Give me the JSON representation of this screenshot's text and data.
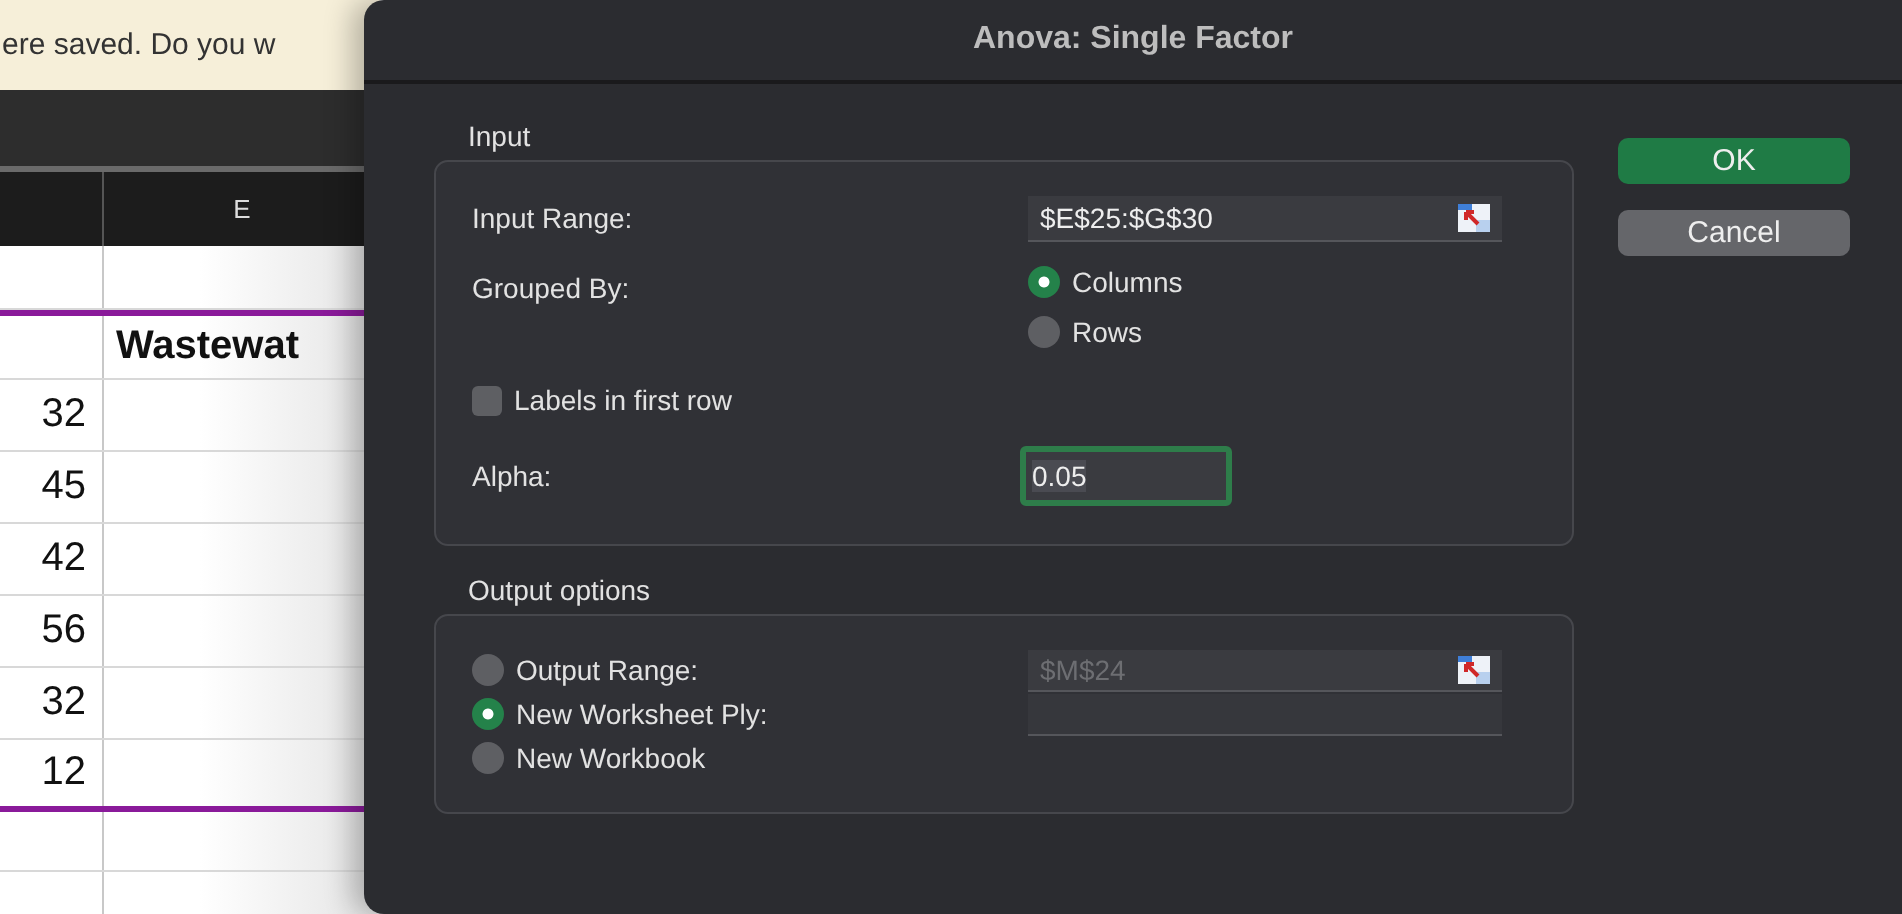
{
  "spreadsheet": {
    "notification": "ere saved. Do you w",
    "column_header": "E",
    "heading_cell": "Wastewat",
    "values": [
      "32",
      "45",
      "42",
      "56",
      "32",
      "12"
    ]
  },
  "dialog": {
    "title": "Anova: Single Factor",
    "input": {
      "label": "Input",
      "range_label": "Input Range:",
      "range_value": "$E$25:$G$30",
      "grouped_by_label": "Grouped By:",
      "grouped_options": [
        {
          "label": "Columns",
          "selected": true
        },
        {
          "label": "Rows",
          "selected": false
        }
      ],
      "labels_checkbox": {
        "label": "Labels in first row",
        "checked": false
      },
      "alpha_label": "Alpha:",
      "alpha_value": "0.05"
    },
    "output": {
      "label": "Output options",
      "options": [
        {
          "label": "Output Range:",
          "selected": false,
          "kind": "range",
          "value": "$M$24",
          "disabled": true
        },
        {
          "label": "New Worksheet Ply:",
          "selected": true,
          "kind": "text"
        },
        {
          "label": "New Workbook",
          "selected": false,
          "kind": "none"
        }
      ]
    },
    "buttons": [
      {
        "label": "OK",
        "primary": true
      },
      {
        "label": "Cancel",
        "primary": false
      }
    ]
  }
}
